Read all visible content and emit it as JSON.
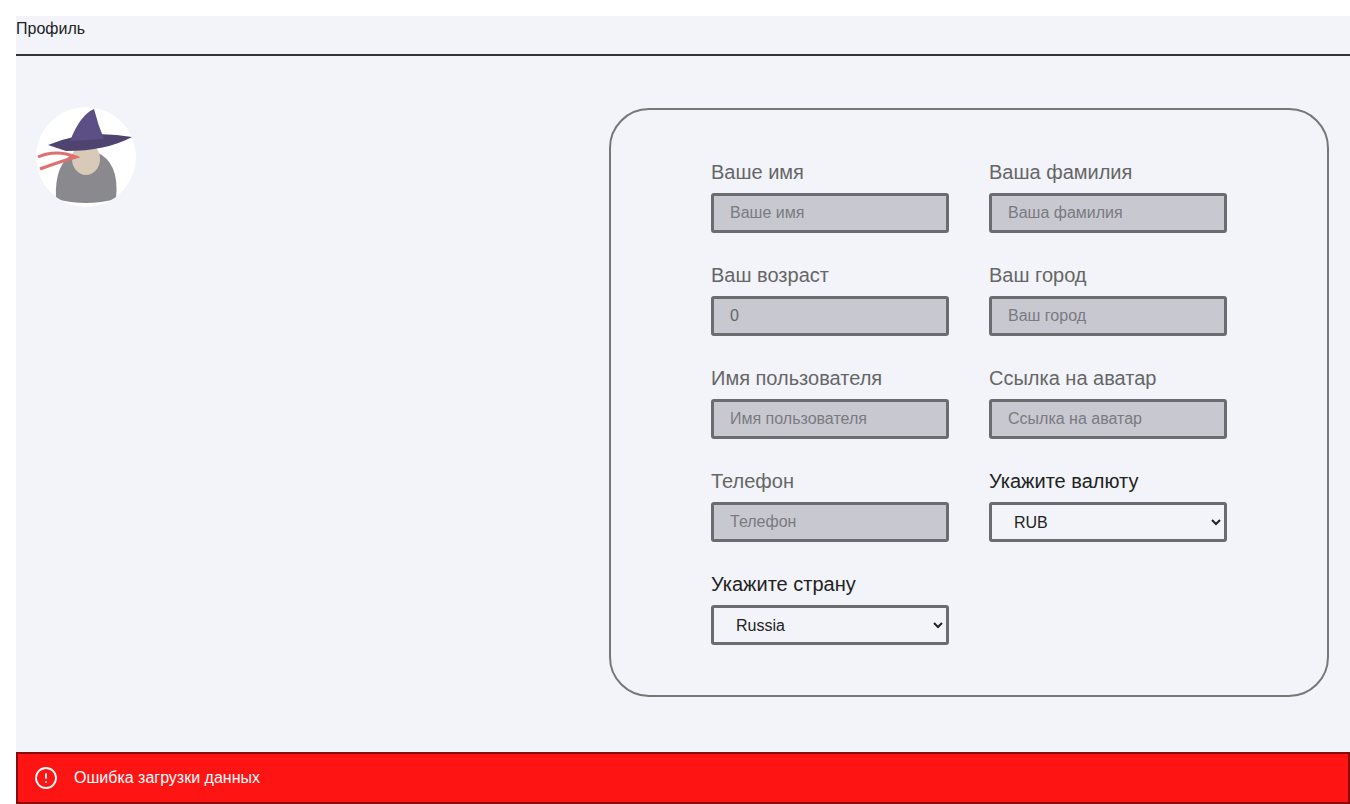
{
  "header": {
    "title": "Профиль"
  },
  "form": {
    "fields": [
      {
        "kind": "input",
        "label": "Ваше имя",
        "placeholder": "Ваше имя"
      },
      {
        "kind": "input",
        "label": "Ваша фамилия",
        "placeholder": "Ваша фамилия"
      },
      {
        "kind": "input",
        "label": "Ваш возраст",
        "value": "0"
      },
      {
        "kind": "input",
        "label": "Ваш город",
        "placeholder": "Ваш город"
      },
      {
        "kind": "input",
        "label": "Имя пользователя",
        "placeholder": "Имя пользователя"
      },
      {
        "kind": "input",
        "label": "Ссылка на аватар",
        "placeholder": "Ссылка на аватар"
      },
      {
        "kind": "input",
        "label": "Телефон",
        "placeholder": "Телефон"
      },
      {
        "kind": "select",
        "label": "Укажите валюту",
        "value": "RUB"
      },
      {
        "kind": "select",
        "label": "Укажите страну",
        "value": "Russia"
      }
    ]
  },
  "error": {
    "message": "Ошибка загрузки данных"
  }
}
